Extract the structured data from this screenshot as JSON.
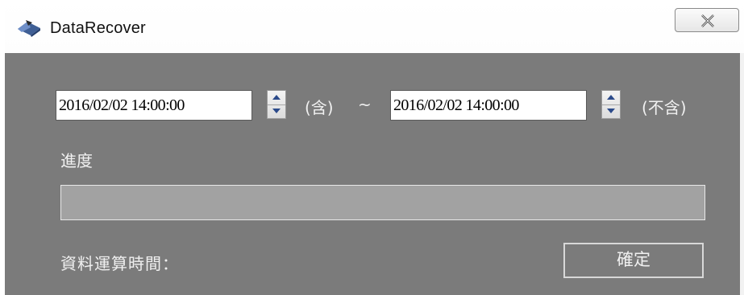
{
  "window": {
    "title": "DataRecover",
    "app_icon": "datarecover-app-icon",
    "close_icon": "close-icon"
  },
  "range": {
    "start_value": "2016/02/02 14:00:00",
    "start_suffix": "(含)",
    "separator": "~",
    "end_value": "2016/02/02 14:00:00",
    "end_suffix": "(不含)"
  },
  "progress": {
    "label": "進度",
    "value_percent": 0
  },
  "footer": {
    "compute_time_label": "資料運算時間：",
    "ok_label": "確定"
  },
  "colors": {
    "client_background": "#7b7b7b",
    "progress_track": "#a2a2a2",
    "progress_fill": "#06b025",
    "label_text": "#f0f0f0"
  }
}
